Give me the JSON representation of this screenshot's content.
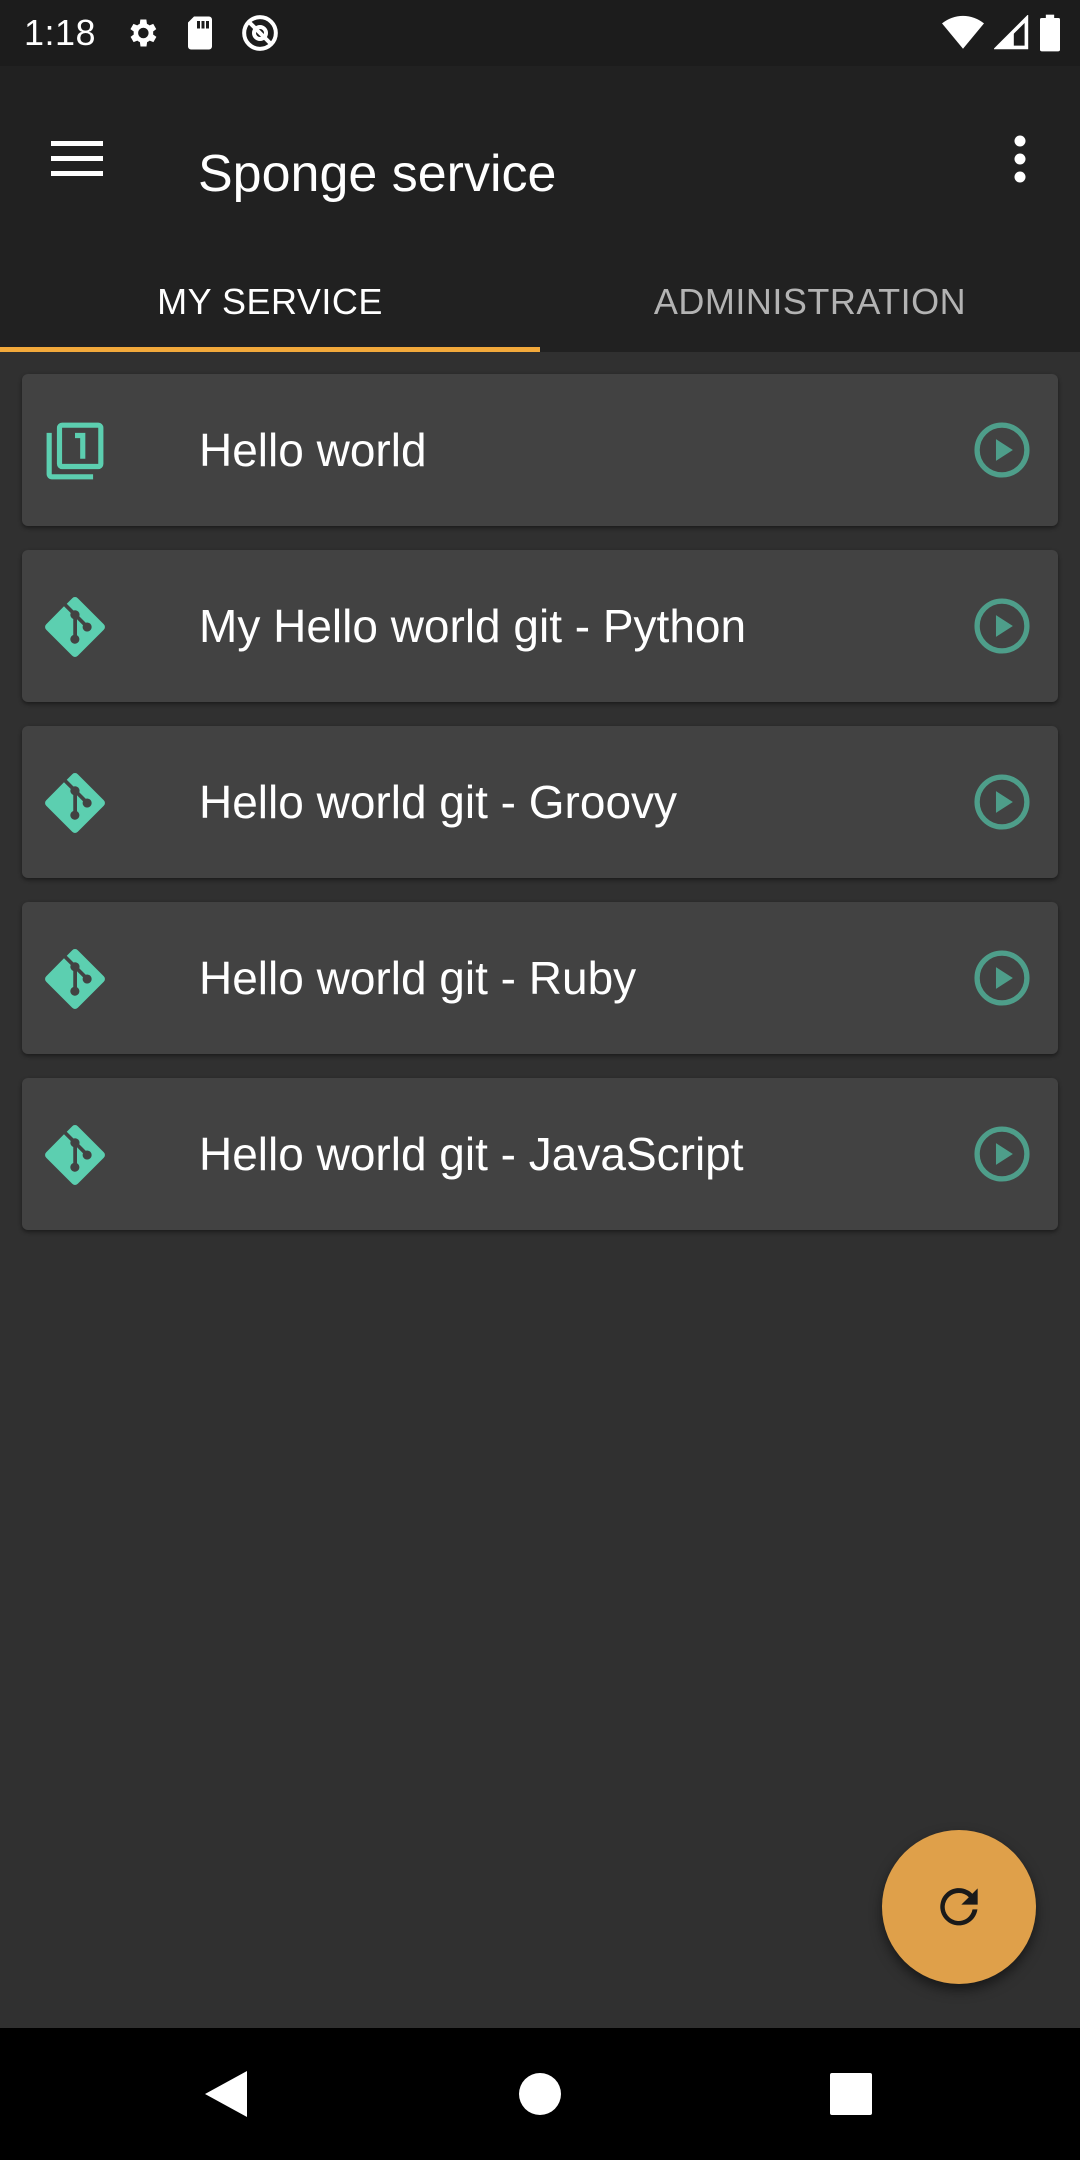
{
  "status_bar": {
    "time": "1:18",
    "left_icons": [
      "gear-icon",
      "sd-card-icon",
      "at-sign-icon"
    ],
    "right_icons": [
      "wifi-icon",
      "cell-signal-icon",
      "battery-icon"
    ]
  },
  "app_bar": {
    "title": "Sponge service",
    "menu_icon": "hamburger-icon",
    "overflow_icon": "more-vert-icon"
  },
  "tabs": [
    {
      "label": "MY SERVICE",
      "active": true
    },
    {
      "label": "ADMINISTRATION",
      "active": false
    }
  ],
  "actions": [
    {
      "label": "Hello world",
      "icon": "numbered-pages-icon"
    },
    {
      "label": "My Hello world git - Python",
      "icon": "git-icon"
    },
    {
      "label": "Hello world git - Groovy",
      "icon": "git-icon"
    },
    {
      "label": "Hello world git - Ruby",
      "icon": "git-icon"
    },
    {
      "label": "Hello world git - JavaScript",
      "icon": "git-icon"
    }
  ],
  "fab_icon": "refresh-icon",
  "nav_bar": [
    "back-icon",
    "home-icon",
    "recents-icon"
  ],
  "colors": {
    "accent": "#f2a93b",
    "fab": "#dfa04a",
    "icon_teal": "#5ccfb0",
    "run_teal": "#4e9e8a"
  }
}
